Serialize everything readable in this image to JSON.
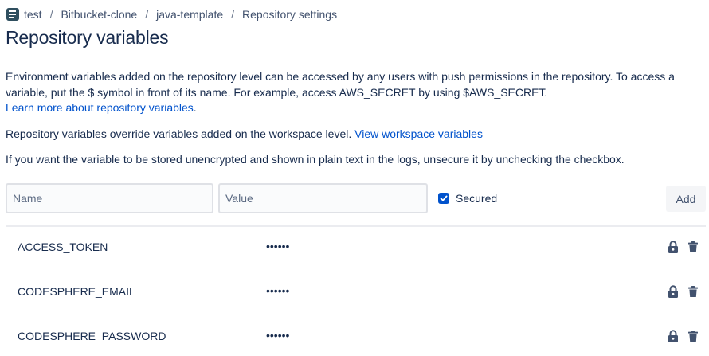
{
  "breadcrumb": {
    "items": [
      "test",
      "Bitbucket-clone",
      "java-template",
      "Repository settings"
    ],
    "separator": "/"
  },
  "page": {
    "title": "Repository variables"
  },
  "intro": {
    "text": "Environment variables added on the repository level can be accessed by any users with push permissions in the repository. To access a variable, put the $ symbol in front of its name. For example, access AWS_SECRET by using $AWS_SECRET.",
    "link": "Learn more about repository variables",
    "link_suffix": "."
  },
  "override": {
    "text": "Repository variables override variables added on the workspace level.",
    "link": "View workspace variables"
  },
  "unsecure_note": "If you want the variable to be stored unencrypted and shown in plain text in the logs, unsecure it by unchecking the checkbox.",
  "form": {
    "name_placeholder": "Name",
    "value_placeholder": "Value",
    "secured_label": "Secured",
    "secured_checked": true,
    "add_label": "Add"
  },
  "variables": [
    {
      "name": "ACCESS_TOKEN",
      "value": "••••••",
      "icons": [
        "lock-icon",
        "trash-icon"
      ]
    },
    {
      "name": "CODESPHERE_EMAIL",
      "value": "••••••",
      "icons": [
        "lock-icon",
        "trash-icon"
      ]
    },
    {
      "name": "CODESPHERE_PASSWORD",
      "value": "••••••",
      "icons": [
        "lock-icon",
        "trash-icon"
      ]
    }
  ],
  "colors": {
    "link": "#0052cc",
    "text": "#172b4d",
    "checkbox": "#0052cc",
    "icon": "#42526e"
  }
}
